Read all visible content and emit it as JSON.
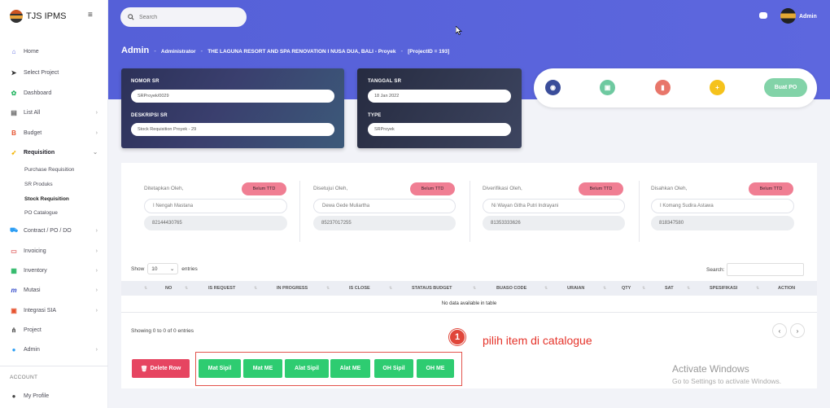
{
  "app": {
    "brand": "TJS IPMS"
  },
  "sidebar": {
    "items": [
      {
        "label": "Home",
        "icon": "home-icon"
      },
      {
        "label": "Select Project",
        "icon": "send-icon"
      },
      {
        "label": "Dashboard",
        "icon": "gear-icon"
      },
      {
        "label": "List All",
        "icon": "document-icon"
      },
      {
        "label": "Budget",
        "icon": "budget-icon"
      },
      {
        "label": "Requisition",
        "icon": "rocket-icon"
      },
      {
        "label": "Contract / PO / DO",
        "icon": "cart-icon"
      },
      {
        "label": "Invoicing",
        "icon": "invoice-icon"
      },
      {
        "label": "Inventory",
        "icon": "inventory-icon"
      },
      {
        "label": "Mutasi",
        "icon": "mutasi-icon"
      },
      {
        "label": "Integrasi SIA",
        "icon": "integration-icon"
      },
      {
        "label": "Project",
        "icon": "sitemap-icon"
      },
      {
        "label": "Admin",
        "icon": "user-icon"
      }
    ],
    "sub_items": [
      "Purchase Requisition",
      "SR Produks",
      "Stock Requisition",
      "PO Catalogue"
    ],
    "account_label": "ACCOUNT",
    "profile_label": "My Profile"
  },
  "header": {
    "search_placeholder": "Search",
    "admin_name": "Admin"
  },
  "breadcrumb": {
    "root": "Admin",
    "sep": "-",
    "role": "Administrator",
    "project": "THE LAGUNA RESORT AND SPA RENOVATION I NUSA DUA, BALI - Proyek",
    "project_id": "[ProjectID = 193]"
  },
  "sr_card": {
    "nomor_label": "NOMOR SR",
    "nomor_value": "SRProyek/0029",
    "deskripsi_label": "DESKRIPSI SR",
    "deskripsi_value": "Stock Requisition Proyek - 29"
  },
  "date_card": {
    "tanggal_label": "TANGGAL SR",
    "tanggal_value": "18 Jan 2022",
    "type_label": "TYPE",
    "type_value": "SRProyek"
  },
  "actions": {
    "buat_po": "Buat PO"
  },
  "signatures": [
    {
      "title": "Ditetapkan Oleh,",
      "status": "Belum TTD",
      "name": "I Nengah Mastana",
      "phone": "82144430765"
    },
    {
      "title": "Disetujui Oleh,",
      "status": "Belum TTD",
      "name": "Dewa Gede Muliartha",
      "phone": "85237017255"
    },
    {
      "title": "Diverifikasi Oleh,",
      "status": "Belum TTD",
      "name": "Ni Wayan Githa Putri Indrayani",
      "phone": "81353333626"
    },
    {
      "title": "Disahkan Oleh,",
      "status": "Belum TTD",
      "name": "I Komang Sudira Astawa",
      "phone": "818347580"
    }
  ],
  "table": {
    "show_label": "Show",
    "entries_value": "10",
    "entries_label": "entries",
    "search_label": "Search:",
    "columns": [
      "NO",
      "IS REQUEST",
      "IN PROGRESS",
      "IS CLOSE",
      "STATAUS BUDGET",
      "BUASO CODE",
      "URAIAN",
      "QTY",
      "SAT",
      "SPESIFIKASI",
      "ACTION"
    ],
    "empty_text": "No data available in table",
    "info": "Showing 0 to 0 of 0 entries",
    "prev": "‹",
    "next": "›"
  },
  "footer_buttons": {
    "delete": "Delete Row",
    "catalogue": [
      "Mat Sipil",
      "Mat ME",
      "Alat Sipil",
      "Alat ME",
      "OH Sipil",
      "OH ME"
    ]
  },
  "annotation": {
    "number": "1",
    "text": "pilih item di catalogue"
  },
  "watermark": {
    "title": "Activate Windows",
    "subtitle": "Go to Settings to activate Windows."
  },
  "colors": {
    "accent": "#5863db",
    "green": "#2ecc71",
    "danger": "#e64561",
    "ttd": "#f07e93"
  }
}
